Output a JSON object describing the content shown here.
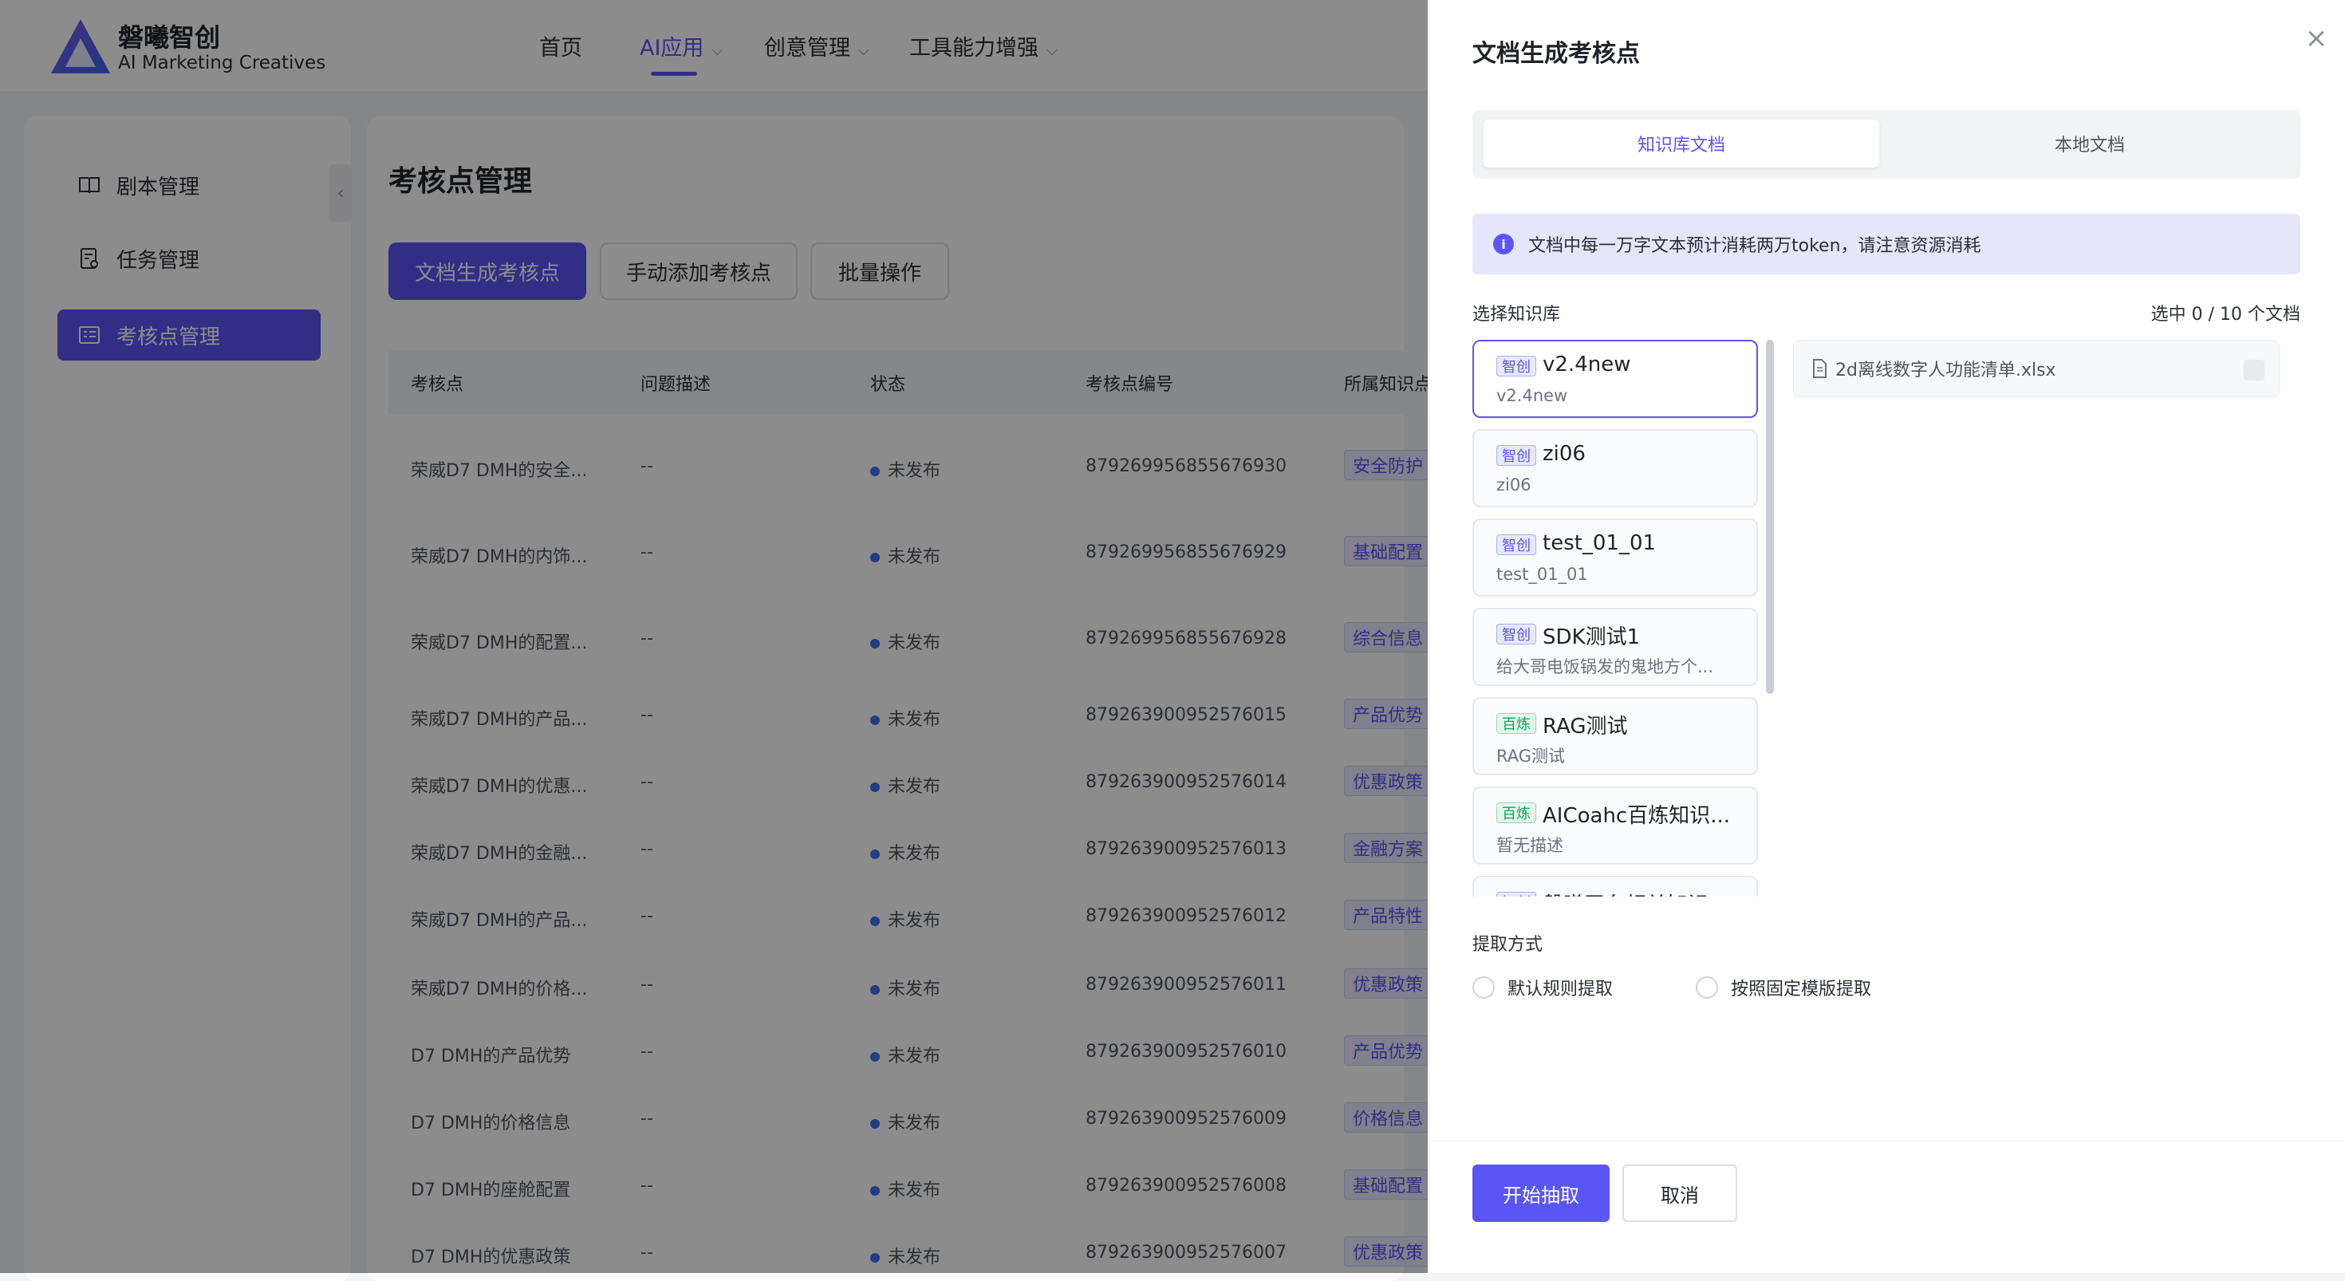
{
  "header": {
    "brand_name": "磐曦智创",
    "brand_sub": "AI Marketing Creatives",
    "nav": [
      {
        "label": "首页"
      },
      {
        "label": "AI应用",
        "active": true
      },
      {
        "label": "创意管理"
      },
      {
        "label": "工具能力增强"
      }
    ]
  },
  "sidebar": {
    "items": [
      {
        "label": "剧本管理"
      },
      {
        "label": "任务管理"
      },
      {
        "label": "考核点管理",
        "active": true
      }
    ]
  },
  "main": {
    "title": "考核点管理",
    "buttons": {
      "generate": "文档生成考核点",
      "manual_add": "手动添加考核点",
      "batch": "批量操作"
    },
    "columns": [
      "考核点",
      "问题描述",
      "状态",
      "考核点编号",
      "所属知识点"
    ],
    "rows": [
      {
        "name": "荣威D7 DMH的安全...",
        "desc": "--",
        "status": "未发布",
        "code": "879269956855676930",
        "tag": "安全防护"
      },
      {
        "name": "荣威D7 DMH的内饰...",
        "desc": "--",
        "status": "未发布",
        "code": "879269956855676929",
        "tag": "基础配置"
      },
      {
        "name": "荣威D7 DMH的配置...",
        "desc": "--",
        "status": "未发布",
        "code": "879269956855676928",
        "tag": "综合信息"
      },
      {
        "name": "荣威D7 DMH的产品...",
        "desc": "--",
        "status": "未发布",
        "code": "879263900952576015",
        "tag": "产品优势"
      },
      {
        "name": "荣威D7 DMH的优惠...",
        "desc": "--",
        "status": "未发布",
        "code": "879263900952576014",
        "tag": "优惠政策"
      },
      {
        "name": "荣威D7 DMH的金融...",
        "desc": "--",
        "status": "未发布",
        "code": "879263900952576013",
        "tag": "金融方案"
      },
      {
        "name": "荣威D7 DMH的产品...",
        "desc": "--",
        "status": "未发布",
        "code": "879263900952576012",
        "tag": "产品特性"
      },
      {
        "name": "荣威D7 DMH的价格...",
        "desc": "--",
        "status": "未发布",
        "code": "879263900952576011",
        "tag": "优惠政策"
      },
      {
        "name": "D7 DMH的产品优势",
        "desc": "--",
        "status": "未发布",
        "code": "879263900952576010",
        "tag": "产品优势"
      },
      {
        "name": "D7 DMH的价格信息",
        "desc": "--",
        "status": "未发布",
        "code": "879263900952576009",
        "tag": "价格信息"
      },
      {
        "name": "D7 DMH的座舱配置",
        "desc": "--",
        "status": "未发布",
        "code": "879263900952576008",
        "tag": "基础配置"
      },
      {
        "name": "D7 DMH的优惠政策",
        "desc": "--",
        "status": "未发布",
        "code": "879263900952576007",
        "tag": "优惠政策"
      }
    ]
  },
  "drawer": {
    "title": "文档生成考核点",
    "tabs": [
      "知识库文档",
      "本地文档"
    ],
    "notice": "文档中每一万字文本预计消耗两万token，请注意资源消耗",
    "select_kb_label": "选择知识库",
    "selected_count": "选中 0 / 10 个文档",
    "kbs": [
      {
        "badge": "智创",
        "badge_type": "zc",
        "name": "v2.4new",
        "desc": "v2.4new",
        "selected": true
      },
      {
        "badge": "智创",
        "badge_type": "zc",
        "name": "zi06",
        "desc": "zi06"
      },
      {
        "badge": "智创",
        "badge_type": "zc",
        "name": "test_01_01",
        "desc": "test_01_01"
      },
      {
        "badge": "智创",
        "badge_type": "zc",
        "name": "SDK测试1",
        "desc": "给大哥电饭锅发的鬼地方个..."
      },
      {
        "badge": "百炼",
        "badge_type": "bl",
        "name": "RAG测试",
        "desc": "RAG测试"
      },
      {
        "badge": "百炼",
        "badge_type": "bl",
        "name": "AICoahc百炼知识...",
        "desc": "暂无描述"
      },
      {
        "badge": "智创",
        "badge_type": "zc",
        "name": "磐曦平台相关知识",
        "desc": ""
      }
    ],
    "documents": [
      {
        "name": "2d离线数字人功能清单.xlsx"
      }
    ],
    "extract_label": "提取方式",
    "extract_options": [
      "默认规则提取",
      "按照固定模版提取"
    ],
    "start_button": "开始抽取",
    "cancel_button": "取消"
  },
  "colors": {
    "primary": "#5a55f5",
    "status_dot": "#3f6df5"
  }
}
